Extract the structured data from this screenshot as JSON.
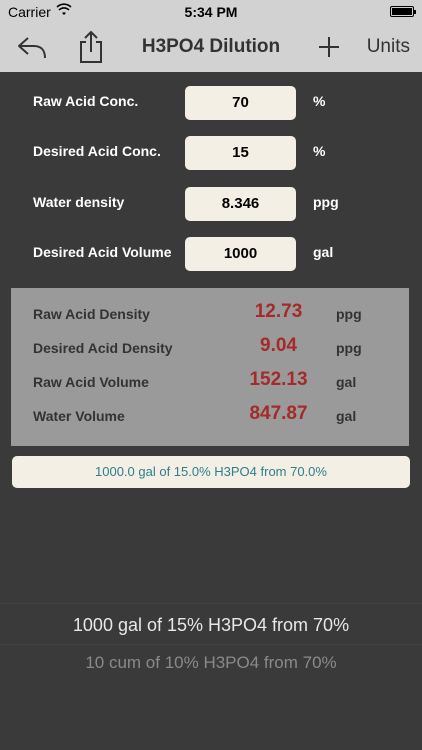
{
  "status_bar": {
    "carrier": "Carrier",
    "time": "5:34 PM"
  },
  "nav": {
    "title": "H3PO4 Dilution",
    "add_label": "+",
    "units_label": "Units"
  },
  "inputs": [
    {
      "label": "Raw Acid Conc.",
      "value": "70",
      "unit": "%"
    },
    {
      "label": "Desired Acid Conc.",
      "value": "15",
      "unit": "%"
    },
    {
      "label": "Water density",
      "value": "8.346",
      "unit": "ppg"
    },
    {
      "label": "Desired Acid Volume",
      "value": "1000",
      "unit": "gal"
    }
  ],
  "results": [
    {
      "label": "Raw Acid Density",
      "value": "12.73",
      "unit": "ppg"
    },
    {
      "label": "Desired Acid Density",
      "value": "9.04",
      "unit": "ppg"
    },
    {
      "label": "Raw Acid Volume",
      "value": "152.13",
      "unit": "gal"
    },
    {
      "label": "Water Volume",
      "value": "847.87",
      "unit": "gal"
    }
  ],
  "summary": "1000.0 gal of 15.0% H3PO4 from 70.0%",
  "picker": {
    "selected": "1000 gal of 15% H3PO4 from 70%",
    "next": "10 cum of 10% H3PO4 from 70%"
  }
}
